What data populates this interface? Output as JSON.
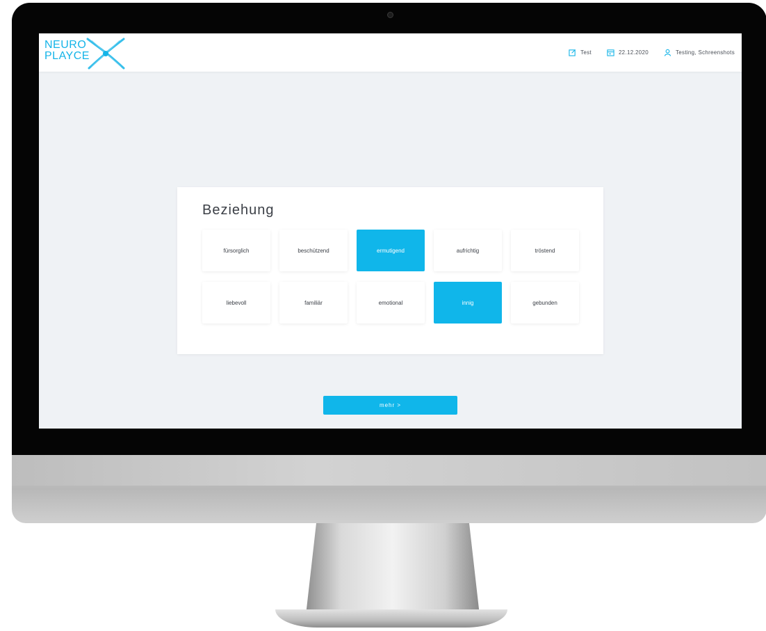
{
  "app": {
    "logo_line1": "NEURO",
    "logo_line2": "PLAYCE",
    "brand_color": "#10b6ea"
  },
  "header": {
    "items": [
      {
        "icon": "edit-icon",
        "label": "Test"
      },
      {
        "icon": "calendar-icon",
        "label": "22.12.2020"
      },
      {
        "icon": "user-icon",
        "label": "Testing, Schreenshots"
      }
    ]
  },
  "main": {
    "title": "Beziehung",
    "options": [
      {
        "label": "fürsorglich",
        "selected": false
      },
      {
        "label": "beschützend",
        "selected": false
      },
      {
        "label": "ermutigend",
        "selected": true
      },
      {
        "label": "aufrichtig",
        "selected": false
      },
      {
        "label": "tröstend",
        "selected": false
      },
      {
        "label": "liebevoll",
        "selected": false
      },
      {
        "label": "familiär",
        "selected": false
      },
      {
        "label": "emotional",
        "selected": false
      },
      {
        "label": "innig",
        "selected": true
      },
      {
        "label": "gebunden",
        "selected": false
      }
    ],
    "more_label": "mehr >"
  }
}
